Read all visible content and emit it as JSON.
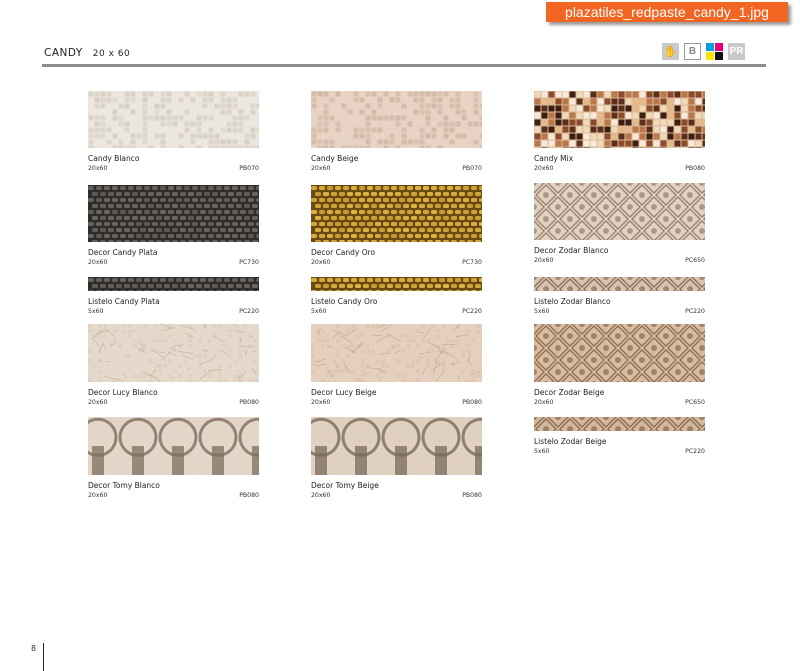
{
  "file_tag": "plazatiles_redpaste_candy_1.jpg",
  "header": {
    "title": "CANDY",
    "size": "20 x 60"
  },
  "icons": [
    {
      "name": "hand-icon",
      "glyph": "✋"
    },
    {
      "name": "b-icon",
      "label": "B"
    },
    {
      "name": "cmyk-icon"
    },
    {
      "name": "pr-icon",
      "label": "PR"
    }
  ],
  "page_number": "8",
  "columns": [
    [
      {
        "name": "Candy Blanco",
        "size": "20x60",
        "code": "PB070",
        "pattern": "mosaic",
        "c1": "#ece7de",
        "c2": "#d6cfc3"
      },
      {
        "name": "Decor Candy Plata",
        "size": "20x60",
        "code": "PC730",
        "pattern": "weave",
        "c1": "#6a6662",
        "c2": "#2f2c2a"
      },
      {
        "name": "Listelo Candy Plata",
        "size": "5x60",
        "code": "PC220",
        "pattern": "weave",
        "c1": "#6a6662",
        "c2": "#2f2c2a"
      },
      {
        "name": "Decor Lucy Blanco",
        "size": "20x60",
        "code": "PB080",
        "pattern": "crackle",
        "c1": "#e5d9cc",
        "c2": "#bba995"
      },
      {
        "name": "Decor Tomy Blanco",
        "size": "20x60",
        "code": "PB080",
        "pattern": "tomy",
        "c1": "#e3d6c8",
        "c2": "#7d6e60"
      }
    ],
    [
      {
        "name": "Candy Beige",
        "size": "20x60",
        "code": "PB070",
        "pattern": "mosaic",
        "c1": "#e8d3c4",
        "c2": "#d2b9a7"
      },
      {
        "name": "Decor Candy Oro",
        "size": "20x60",
        "code": "PC730",
        "pattern": "weave",
        "c1": "#e0b440",
        "c2": "#6a4a12"
      },
      {
        "name": "Listelo Candy Oro",
        "size": "5x60",
        "code": "PC220",
        "pattern": "weave",
        "c1": "#e0b440",
        "c2": "#6a4a12"
      },
      {
        "name": "Decor Lucy Beige",
        "size": "20x60",
        "code": "PB080",
        "pattern": "crackle",
        "c1": "#e5d0bf",
        "c2": "#b99e88"
      },
      {
        "name": "Decor Tomy Beige",
        "size": "20x60",
        "code": "PB080",
        "pattern": "tomy",
        "c1": "#e0d0c0",
        "c2": "#7a6a5c"
      }
    ],
    [
      {
        "name": "Candy Mix",
        "size": "20x60",
        "code": "PB080",
        "pattern": "mix",
        "c1": "#d9b99a",
        "c2": "#5a3020"
      },
      {
        "name": "Decor Zodar Blanco",
        "size": "20x60",
        "code": "PC650",
        "pattern": "damask",
        "c1": "#e2d2c4",
        "c2": "#8a6f5c"
      },
      {
        "name": "Listelo Zodar Blanco",
        "size": "5x60",
        "code": "PC220",
        "pattern": "damask",
        "c1": "#d8c4b2",
        "c2": "#7a5f4c"
      },
      {
        "name": "Decor Zodar Beige",
        "size": "20x60",
        "code": "PC650",
        "pattern": "damask",
        "c1": "#d9bea2",
        "c2": "#7d5c42"
      },
      {
        "name": "Listelo Zodar Beige",
        "size": "5x60",
        "code": "PC220",
        "pattern": "damask",
        "c1": "#d3b89e",
        "c2": "#7a5a40"
      }
    ]
  ]
}
